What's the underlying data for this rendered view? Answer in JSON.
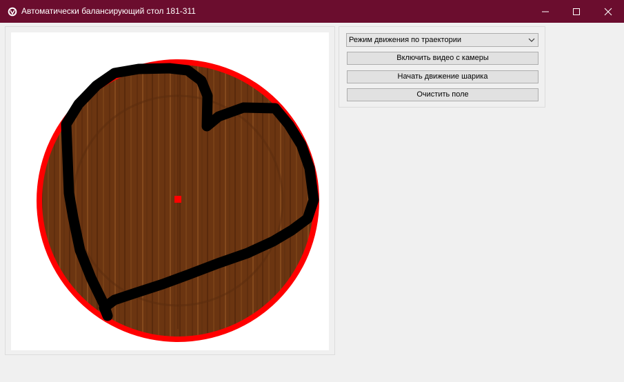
{
  "window": {
    "title": "Автоматически балансирующий стол 181-311",
    "titlebar_color": "#6b0d2e"
  },
  "icons": {
    "app": "app-logo-icon",
    "minimize": "minimize-icon",
    "maximize": "maximize-icon",
    "close": "close-icon"
  },
  "controls": {
    "mode_select": {
      "value": "Режим движения по траектории",
      "icon": "chevron-down-icon"
    },
    "camera_button": "Включить видео с камеры",
    "start_button": "Начать движение шарика",
    "clear_button": "Очистить поле"
  },
  "board": {
    "rim_color": "#ff0000",
    "trajectory_color": "#000000",
    "ball_color": "#ff0000",
    "wood_color": "#6b3511"
  }
}
